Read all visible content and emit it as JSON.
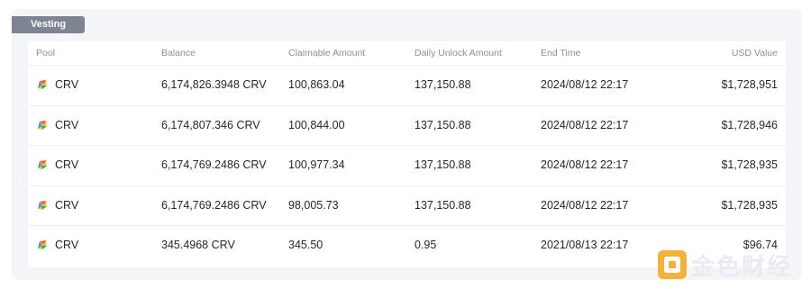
{
  "section": {
    "title": "Vesting"
  },
  "table": {
    "headers": [
      "Pool",
      "Balance",
      "Claimable Amount",
      "Daily Unlock Amount",
      "End Time",
      "USD Value"
    ],
    "rows": [
      {
        "pool": "CRV",
        "balance": "6,174,826.3948 CRV",
        "claimable": "100,863.04",
        "daily": "137,150.88",
        "end": "2024/08/12 22:17",
        "usd": "$1,728,951"
      },
      {
        "pool": "CRV",
        "balance": "6,174,807.346 CRV",
        "claimable": "100,844.00",
        "daily": "137,150.88",
        "end": "2024/08/12 22:17",
        "usd": "$1,728,946"
      },
      {
        "pool": "CRV",
        "balance": "6,174,769.2486 CRV",
        "claimable": "100,977.34",
        "daily": "137,150.88",
        "end": "2024/08/12 22:17",
        "usd": "$1,728,935"
      },
      {
        "pool": "CRV",
        "balance": "6,174,769.2486 CRV",
        "claimable": "98,005.73",
        "daily": "137,150.88",
        "end": "2024/08/12 22:17",
        "usd": "$1,728,935"
      },
      {
        "pool": "CRV",
        "balance": "345.4968 CRV",
        "claimable": "345.50",
        "daily": "0.95",
        "end": "2021/08/13 22:17",
        "usd": "$96.74"
      }
    ]
  },
  "watermark": {
    "text": "金色财经",
    "icon": "jinse-logo-icon"
  },
  "colors": {
    "tag_bg": "#7f8494",
    "panel_bg": "#f4f5f8",
    "header_text": "#8a8f9c",
    "text": "#1f2430"
  }
}
